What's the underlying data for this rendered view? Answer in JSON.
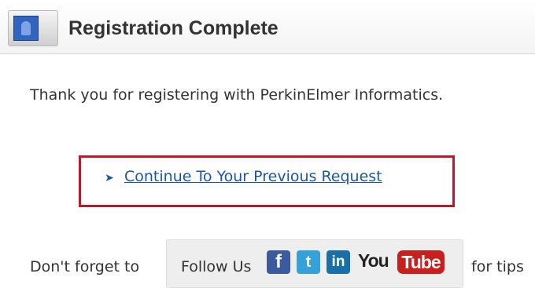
{
  "header": {
    "title": "Registration Complete",
    "icon": "user-profile-icon"
  },
  "message": {
    "thanks": "Thank you for registering with PerkinElmer Informatics."
  },
  "continue": {
    "arrow": "➤",
    "label": "Continue To Your Previous Request",
    "highlight_color": "#c01828"
  },
  "social": {
    "prefix": "Don't forget to",
    "follow_label": "Follow Us",
    "suffix": "for tips",
    "icons": [
      {
        "name": "facebook-icon",
        "glyph": "f",
        "color": "#3b5b9e"
      },
      {
        "name": "twitter-icon",
        "glyph": "t",
        "color": "#34a1d8"
      },
      {
        "name": "linkedin-icon",
        "glyph": "in",
        "color": "#1b6fa8"
      }
    ],
    "youtube": {
      "you": "You",
      "tube": "Tube",
      "color": "#c8201e"
    }
  },
  "colors": {
    "link": "#1a56a8"
  }
}
